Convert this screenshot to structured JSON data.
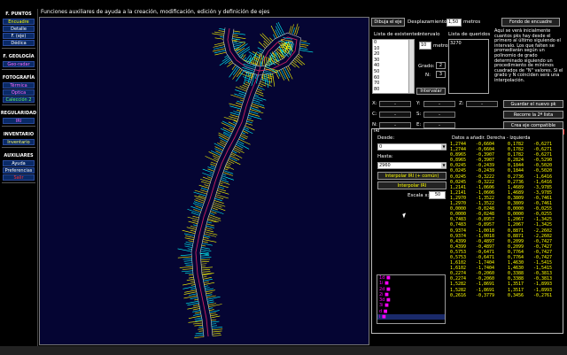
{
  "window": {
    "title": "Funciones auxiliares de ayuda a la creación, modificación, edición y definición de ejes"
  },
  "sidebar": {
    "sections": [
      {
        "header": "F. PUNTOS",
        "items": [
          {
            "label": "Encuadre",
            "color": "#ffff00"
          },
          {
            "label": "Detalle",
            "color": "#ffffff"
          },
          {
            "label": "F. (eje)",
            "color": "#ffffff"
          },
          {
            "label": "Dédica",
            "color": "#ffffff"
          }
        ]
      },
      {
        "header": "F. GEOLOGÍA",
        "items": [
          {
            "label": "Geo-radar",
            "color": "#ff66ff"
          }
        ]
      },
      {
        "header": "FOTOGRAFÍA",
        "items": [
          {
            "label": "Térmica",
            "color": "#ff66ff"
          },
          {
            "label": "Óptica",
            "color": "#ff66ff"
          },
          {
            "label": "Calección 2",
            "color": "#66ff66"
          }
        ]
      },
      {
        "header": "REGULARIDAD",
        "items": [
          {
            "label": "IRI",
            "color": "#ff66ff"
          }
        ]
      },
      {
        "header": "INVENTARIO",
        "items": [
          {
            "label": "Inventario",
            "color": "#ffff66"
          }
        ]
      },
      {
        "header": "AUXILIARES",
        "items": [
          {
            "label": "Ayuda",
            "color": "#ffffff"
          },
          {
            "label": "Preferencias",
            "color": "#ffffff"
          },
          {
            "label": "Salir",
            "color": "#ff3333"
          }
        ]
      }
    ]
  },
  "toolbar": {
    "draw_axis_label": "Dibuja el eje",
    "displacement_label": "Desplazamiento:",
    "displacement_value": "1,50",
    "displacement_unit": "metros",
    "background_label": "Fondo de encuadre"
  },
  "lists": {
    "existing_header": "Lista de existentes",
    "interval_header": "Intervalo",
    "wanted_header": "Lista de queridos",
    "existing_items": [
      "0",
      "10",
      "20",
      "30",
      "40",
      "50",
      "60",
      "70",
      "80"
    ],
    "interval_value": "10",
    "interval_unit": "metros",
    "wanted_value": "3270",
    "grado_label": "Grado:",
    "grado_value": "2",
    "n_label": "N:",
    "n_value": "3",
    "interpolate_label": "Intervalar",
    "info_text": "Aquí se verá inicialmente cuantos pks hay desde el primero al último siguiendo el intervalo. Los que falten se promediarán según un polinomio de grado determinado siguiendo un procedimiento de mínimos cuadrados de \"N\" valores. Si el grado y N coinciden será una interpolación."
  },
  "coords": {
    "x_label": "X:",
    "y_label": "Y:",
    "z_label": "Z:",
    "c_label": "C:",
    "s_label": "S:",
    "n_label": "N:",
    "e_label": "E:",
    "x_value": "-",
    "y_value": "-",
    "z_value": "-",
    "c_value": "-",
    "s_value": "-",
    "n_value": "-",
    "e_value": "-",
    "save_pk": "Guardar el nuevo pk",
    "recount": "Recorre la 2ª lista",
    "create_axis": "Crea eje compatible"
  },
  "iri": {
    "frame_label": "IRI",
    "desde_label": "Desde:",
    "desde_value": "0",
    "hasta_label": "Hasta:",
    "hasta_value": "2960",
    "interp_combined": "Interpolar IRI (+ común)",
    "interp_iri": "Interpolar IRI",
    "escala_label": "Escala x:",
    "escala_value": "50",
    "table_header": "Datos a añadir. Derecha - Izquierda",
    "rows": [
      [
        "1,2744",
        "-0,6604",
        "0,1782",
        "-0,6271"
      ],
      [
        "1,2744",
        "-0,6604",
        "0,1782",
        "-0,6271"
      ],
      [
        "0,8965",
        "-0,3907",
        "0,1782",
        "-0,6271"
      ],
      [
        "0,8965",
        "-0,3907",
        "0,2824",
        "-0,5290"
      ],
      [
        "0,0245",
        "-0,2439",
        "0,1844",
        "-0,5020"
      ],
      [
        "0,0245",
        "-0,2439",
        "0,1844",
        "-0,5020"
      ],
      [
        "0,0245",
        "-0,3222",
        "0,2736",
        "-1,6416"
      ],
      [
        "0,0245",
        "-0,3222",
        "0,2736",
        "-1,6416"
      ],
      [
        "1,2141",
        "-1,0606",
        "1,4689",
        "-3,9785"
      ],
      [
        "1,2141",
        "-1,0606",
        "1,4689",
        "-3,9785"
      ],
      [
        "1,2970",
        "-1,3522",
        "0,3809",
        "-0,7461"
      ],
      [
        "1,2970",
        "-1,3522",
        "0,3809",
        "-0,7461"
      ],
      [
        "0,0000",
        "-0,0248",
        "0,0000",
        "-0,0255"
      ],
      [
        "0,0000",
        "-0,0248",
        "0,0000",
        "-0,0255"
      ],
      [
        "0,7483",
        "-0,8957",
        "1,2067",
        "-1,3425"
      ],
      [
        "0,7483",
        "-0,8957",
        "1,2067",
        "-1,3425"
      ],
      [
        "0,9374",
        "-1,0018",
        "0,8871",
        "-2,2602"
      ],
      [
        "0,9374",
        "-1,0018",
        "0,8871",
        "-2,2602"
      ],
      [
        "0,4399",
        "-0,4897",
        "0,2099",
        "-0,7427"
      ],
      [
        "0,4399",
        "-0,4897",
        "0,2099",
        "-0,7427"
      ],
      [
        "0,5753",
        "-0,6471",
        "0,7764",
        "-0,7427"
      ],
      [
        "0,5753",
        "-0,6471",
        "0,7764",
        "-0,7427"
      ],
      [
        "1,6102",
        "-1,7404",
        "1,4630",
        "-1,5415"
      ],
      [
        "1,6102",
        "-1,7404",
        "1,4630",
        "-1,5415"
      ],
      [
        "0,2274",
        "-0,2060",
        "0,3388",
        "-0,3813"
      ],
      [
        "0,2274",
        "-0,2060",
        "0,3388",
        "-0,3813"
      ],
      [
        "1,5282",
        "-1,8691",
        "1,3517",
        "-1,8993"
      ],
      [
        "1,5282",
        "-1,8691",
        "1,3517",
        "-1,8993"
      ],
      [
        "0,2616",
        "-0,3779",
        "0,3456",
        "-0,2761"
      ]
    ],
    "layers": [
      {
        "label": "1d ■",
        "selected": false
      },
      {
        "label": "1i ■",
        "selected": false
      },
      {
        "label": "2d ■",
        "selected": false
      },
      {
        "label": "2i ■",
        "selected": false
      },
      {
        "label": "3d ■",
        "selected": false
      },
      {
        "label": "3i ■",
        "selected": false
      },
      {
        "label": "d ■",
        "selected": false
      },
      {
        "label": "i ■",
        "selected": true
      }
    ]
  },
  "colors": {
    "accent_yellow": "#ffff00",
    "iri_cyan": "#00ffff",
    "axis_magenta": "#cc2266",
    "canvas_bg": "#050533"
  }
}
